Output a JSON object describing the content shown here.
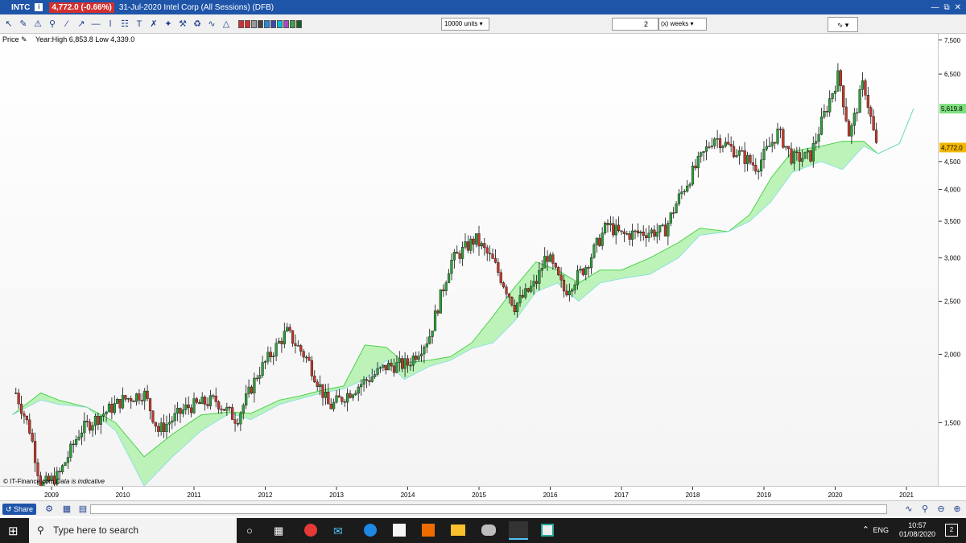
{
  "window": {
    "ticker": "INTC",
    "price_badge": "4,772.0 (-0.66%)",
    "description": "31-Jul-2020 Intel Corp (All Sessions) (DFB)"
  },
  "toolbar": {
    "units": "10000 units",
    "period_value": "2",
    "period_unit": "(x) weeks"
  },
  "chart_header": {
    "price_label": "Price",
    "year_range": "Year:High 6,853.8 Low 4,339.0"
  },
  "footer": {
    "copyright": "© IT-Finance.com",
    "indicative": "Data is indicative",
    "share": "Share"
  },
  "taskbar": {
    "search_placeholder": "Type here to search",
    "lang": "ENG",
    "time": "10:57",
    "date": "01/08/2020",
    "notifications": "2"
  },
  "chart_data": {
    "type": "candlestick",
    "scale": "log",
    "ylim": [
      1150,
      7700
    ],
    "yticks": [
      "7,500",
      "6,500",
      "4,500",
      "4,000",
      "3,500",
      "3,000",
      "2,500",
      "2,000",
      "1,500"
    ],
    "ytick_values": [
      7500,
      6500,
      4500,
      4000,
      3500,
      3000,
      2500,
      2000,
      1500
    ],
    "xticks": [
      "2009",
      "2010",
      "2011",
      "2012",
      "2013",
      "2014",
      "2015",
      "2016",
      "2017",
      "2018",
      "2019",
      "2020",
      "2021"
    ],
    "price_tags": [
      {
        "label": "5,619.8",
        "value": 5620,
        "color": "#7de07d"
      },
      {
        "label": "4,772.0",
        "value": 4772,
        "color": "#f2b800"
      }
    ],
    "price_path": [
      [
        2008.5,
        1700
      ],
      [
        2008.7,
        1450
      ],
      [
        2008.85,
        1150
      ],
      [
        2009.1,
        1200
      ],
      [
        2009.4,
        1450
      ],
      [
        2009.7,
        1550
      ],
      [
        2010.0,
        1650
      ],
      [
        2010.3,
        1700
      ],
      [
        2010.5,
        1450
      ],
      [
        2010.9,
        1600
      ],
      [
        2011.3,
        1650
      ],
      [
        2011.6,
        1520
      ],
      [
        2011.9,
        1850
      ],
      [
        2012.3,
        2200
      ],
      [
        2012.6,
        1950
      ],
      [
        2012.9,
        1600
      ],
      [
        2013.3,
        1750
      ],
      [
        2013.7,
        1900
      ],
      [
        2014.0,
        1920
      ],
      [
        2014.3,
        2150
      ],
      [
        2014.6,
        2950
      ],
      [
        2014.95,
        3250
      ],
      [
        2015.2,
        2950
      ],
      [
        2015.5,
        2450
      ],
      [
        2015.8,
        2700
      ],
      [
        2015.95,
        3050
      ],
      [
        2016.2,
        2600
      ],
      [
        2016.5,
        2900
      ],
      [
        2016.8,
        3450
      ],
      [
        2017.0,
        3300
      ],
      [
        2017.4,
        3350
      ],
      [
        2017.6,
        3350
      ],
      [
        2017.8,
        3850
      ],
      [
        2018.0,
        4300
      ],
      [
        2018.3,
        5000
      ],
      [
        2018.6,
        4700
      ],
      [
        2018.9,
        4400
      ],
      [
        2019.2,
        5100
      ],
      [
        2019.4,
        4550
      ],
      [
        2019.65,
        4600
      ],
      [
        2019.85,
        5500
      ],
      [
        2020.05,
        6500
      ],
      [
        2020.2,
        5000
      ],
      [
        2020.4,
        6300
      ],
      [
        2020.58,
        4772
      ]
    ],
    "cloud_upper": [
      [
        2008.45,
        1550
      ],
      [
        2008.85,
        1700
      ],
      [
        2009.1,
        1650
      ],
      [
        2009.5,
        1600
      ],
      [
        2009.9,
        1500
      ],
      [
        2010.3,
        1300
      ],
      [
        2010.7,
        1430
      ],
      [
        2011.1,
        1550
      ],
      [
        2011.5,
        1570
      ],
      [
        2011.8,
        1560
      ],
      [
        2012.2,
        1650
      ],
      [
        2012.5,
        1680
      ],
      [
        2012.8,
        1720
      ],
      [
        2013.1,
        1750
      ],
      [
        2013.4,
        2080
      ],
      [
        2013.7,
        2060
      ],
      [
        2013.95,
        1930
      ],
      [
        2014.3,
        1950
      ],
      [
        2014.6,
        1980
      ],
      [
        2014.9,
        2100
      ],
      [
        2015.2,
        2350
      ],
      [
        2015.5,
        2650
      ],
      [
        2015.8,
        2950
      ],
      [
        2016.1,
        2850
      ],
      [
        2016.4,
        2700
      ],
      [
        2016.7,
        2850
      ],
      [
        2017.0,
        2850
      ],
      [
        2017.4,
        3000
      ],
      [
        2017.8,
        3200
      ],
      [
        2018.1,
        3400
      ],
      [
        2018.5,
        3350
      ],
      [
        2018.8,
        3600
      ],
      [
        2019.1,
        4200
      ],
      [
        2019.4,
        4700
      ],
      [
        2019.8,
        4800
      ],
      [
        2020.1,
        4900
      ],
      [
        2020.4,
        4900
      ],
      [
        2020.6,
        4650
      ],
      [
        2020.9,
        4850
      ],
      [
        2021.1,
        5620
      ]
    ],
    "cloud_lower": [
      [
        2008.45,
        1550
      ],
      [
        2008.85,
        1650
      ],
      [
        2009.1,
        1620
      ],
      [
        2009.5,
        1600
      ],
      [
        2009.9,
        1450
      ],
      [
        2010.3,
        1150
      ],
      [
        2010.7,
        1300
      ],
      [
        2011.1,
        1450
      ],
      [
        2011.5,
        1560
      ],
      [
        2011.8,
        1520
      ],
      [
        2012.2,
        1620
      ],
      [
        2012.5,
        1660
      ],
      [
        2012.8,
        1700
      ],
      [
        2013.1,
        1730
      ],
      [
        2013.4,
        1800
      ],
      [
        2013.7,
        1950
      ],
      [
        2013.95,
        1800
      ],
      [
        2014.3,
        1900
      ],
      [
        2014.6,
        1950
      ],
      [
        2014.9,
        2050
      ],
      [
        2015.2,
        2100
      ],
      [
        2015.5,
        2300
      ],
      [
        2015.8,
        2600
      ],
      [
        2016.1,
        2700
      ],
      [
        2016.4,
        2500
      ],
      [
        2016.7,
        2700
      ],
      [
        2017.0,
        2750
      ],
      [
        2017.4,
        2800
      ],
      [
        2017.8,
        3000
      ],
      [
        2018.1,
        3300
      ],
      [
        2018.5,
        3350
      ],
      [
        2018.8,
        3500
      ],
      [
        2019.1,
        3800
      ],
      [
        2019.4,
        4300
      ],
      [
        2019.8,
        4500
      ],
      [
        2020.1,
        4350
      ],
      [
        2020.4,
        4800
      ],
      [
        2020.6,
        4650
      ],
      [
        2020.9,
        4850
      ],
      [
        2021.1,
        5620
      ]
    ]
  }
}
